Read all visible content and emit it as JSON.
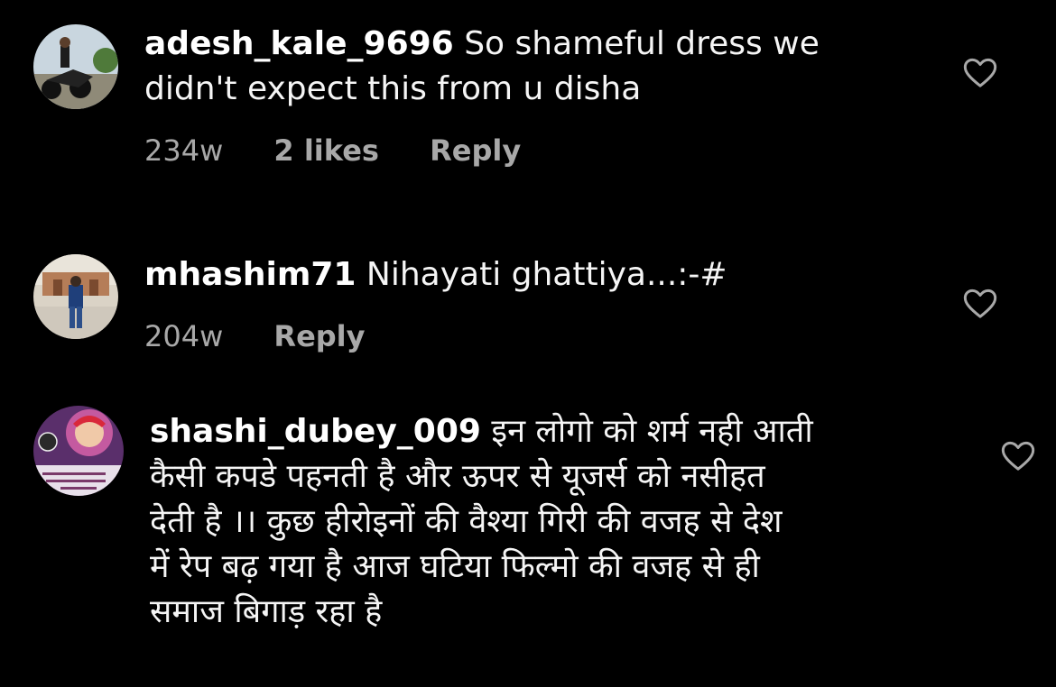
{
  "comments": [
    {
      "username": "adesh_kale_9696",
      "text_line1": "So shameful dress we",
      "text_line2": "didn't expect this from u disha",
      "time": "234w",
      "likes": "2 likes",
      "reply": "Reply"
    },
    {
      "username": "mhashim71",
      "text_line1": "Nihayati ghattiya...:-#",
      "time": "204w",
      "reply": "Reply"
    },
    {
      "username": "shashi_dubey_009",
      "text_line1": "इन लोगो को शर्म नही आती",
      "text_line2": "कैसी कपडे पहनती है  और ऊपर से यूजर्स को नसीहत",
      "text_line3": "देती है ।। कुछ हीरोइनों की वैश्या गिरी की वजह से देश",
      "text_line4": "में रेप बढ़ गया है  आज घटिया फिल्मो की वजह से ही",
      "text_line5": "समाज बिगाड़ रहा है"
    }
  ],
  "colors": {
    "background": "#000000",
    "text": "#f5f5f5",
    "meta": "#a8a8a8"
  },
  "icons": {
    "like": "heart-outline-icon"
  }
}
